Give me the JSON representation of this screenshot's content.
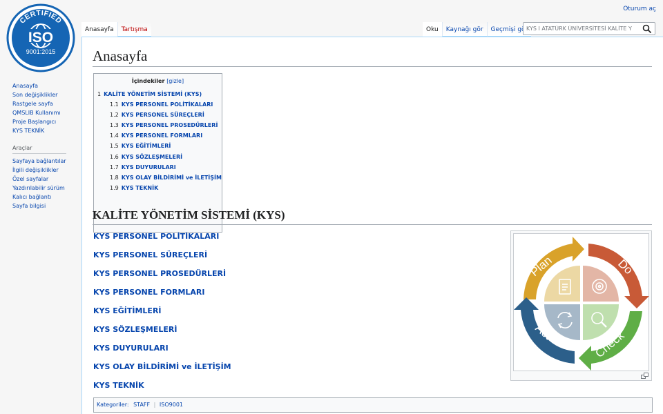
{
  "logo": {
    "top_text": "CERTIFIED",
    "main_text": "ISO",
    "bottom_text": "9001:2015"
  },
  "personal": {
    "login": "Oturum aç"
  },
  "tabs": {
    "left": [
      {
        "label": "Anasayfa"
      },
      {
        "label": "Tartışma"
      }
    ],
    "right": [
      {
        "label": "Oku"
      },
      {
        "label": "Kaynağı gör"
      },
      {
        "label": "Geçmişi gör"
      }
    ]
  },
  "search": {
    "value": "KYS I ATATÜRK ÜNİVERSİTESİ KALİTE Y"
  },
  "sidebar": {
    "nav": [
      {
        "label": "Anasayfa"
      },
      {
        "label": "Son değişiklikler"
      },
      {
        "label": "Rastgele sayfa"
      },
      {
        "label": "QMSLIB Kullanımı"
      },
      {
        "label": "Proje Başlangıcı"
      },
      {
        "label": "KYS TEKNİK"
      }
    ],
    "tools_heading": "Araçlar",
    "tools": [
      {
        "label": "Sayfaya bağlantılar"
      },
      {
        "label": "İlgili değişiklikler"
      },
      {
        "label": "Özel sayfalar"
      },
      {
        "label": "Yazdırılabilir sürüm"
      },
      {
        "label": "Kalıcı bağlantı"
      },
      {
        "label": "Sayfa bilgisi"
      }
    ]
  },
  "page": {
    "title": "Anasayfa"
  },
  "toc": {
    "title": "İçindekiler",
    "toggle": "[gizle]",
    "items": [
      {
        "num": "1",
        "label": "KALİTE YÖNETİM SİSTEMİ (KYS)"
      },
      {
        "num": "1.1",
        "label": "KYS PERSONEL POLİTİKALARI"
      },
      {
        "num": "1.2",
        "label": "KYS PERSONEL SÜREÇLERİ"
      },
      {
        "num": "1.3",
        "label": "KYS PERSONEL PROSEDÜRLERİ"
      },
      {
        "num": "1.4",
        "label": "KYS PERSONEL FORMLARI"
      },
      {
        "num": "1.5",
        "label": "KYS EĞİTİMLERİ"
      },
      {
        "num": "1.6",
        "label": "KYS SÖZLEŞMELERİ"
      },
      {
        "num": "1.7",
        "label": "KYS DUYURULARI"
      },
      {
        "num": "1.8",
        "label": "KYS OLAY BİLDİRİMİ ve İLETİŞİM"
      },
      {
        "num": "1.9",
        "label": "KYS TEKNİK"
      }
    ]
  },
  "section": {
    "heading": "KALİTE YÖNETİM SİSTEMİ (KYS)",
    "links": [
      {
        "label": "KYS PERSONEL POLİTİKALARI"
      },
      {
        "label": "KYS PERSONEL SÜREÇLERİ"
      },
      {
        "label": "KYS PERSONEL PROSEDÜRLERİ"
      },
      {
        "label": "KYS PERSONEL FORMLARI"
      },
      {
        "label": "KYS EĞİTİMLERİ"
      },
      {
        "label": "KYS SÖZLEŞMELERİ"
      },
      {
        "label": "KYS DUYURULARI"
      },
      {
        "label": "KYS OLAY BİLDİRİMİ ve İLETİŞİM"
      },
      {
        "label": "KYS TEKNİK"
      }
    ]
  },
  "pdca": {
    "plan": "Plan",
    "do": "Do",
    "check": "Check",
    "act": "Act",
    "colors": {
      "plan": "#d9a22a",
      "do": "#c85a37",
      "check": "#5fae46",
      "act": "#2c5f8a"
    }
  },
  "categories": {
    "label": "Kategoriler:",
    "items": [
      {
        "label": "STAFF"
      },
      {
        "label": "ISO9001"
      }
    ]
  }
}
